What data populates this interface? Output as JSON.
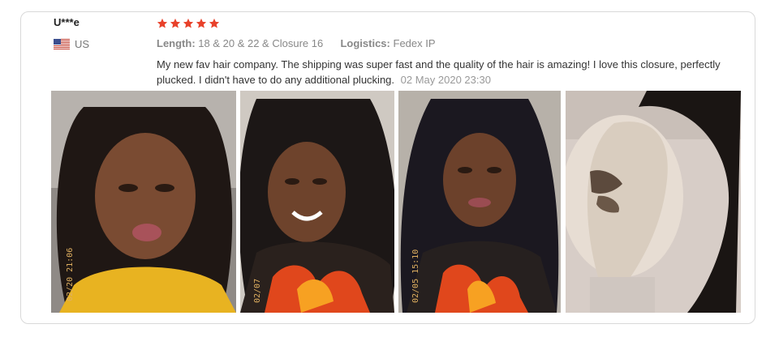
{
  "reviewer": {
    "name": "U***e",
    "country": "US",
    "flag_icon": "us-flag-icon"
  },
  "rating": {
    "stars": 5,
    "max": 5,
    "color": "#e8412a"
  },
  "attributes": {
    "length_label": "Length:",
    "length_value": "18 & 20 & 22 & Closure 16",
    "logistics_label": "Logistics:",
    "logistics_value": "Fedex IP"
  },
  "review": {
    "text": "My new fav hair company. The shipping was super fast and the quality of the hair is amazing! I love this closure, perfectly plucked. I didn't have to do any additional plucking.",
    "date": "02 May 2020 23:30"
  },
  "photos": [
    {
      "stamp": "02/20 21:06"
    },
    {
      "stamp": "02/07"
    },
    {
      "stamp": "02/05 15:10"
    },
    {
      "stamp": ""
    }
  ]
}
